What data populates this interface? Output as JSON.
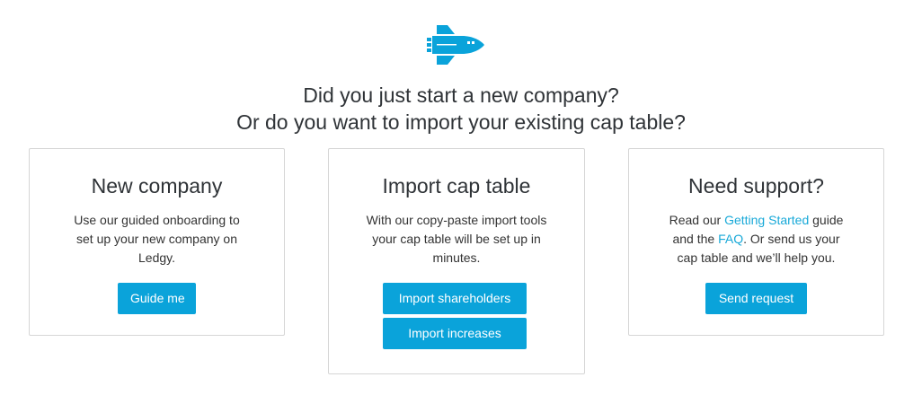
{
  "logo": {
    "icon": "space-shuttle-icon",
    "color": "#0aa3da"
  },
  "headline": {
    "line1": "Did you just start a new company?",
    "line2": "Or do you want to import your existing cap table?"
  },
  "cards": {
    "new_company": {
      "title": "New company",
      "body": "Use our guided onboarding to set up your new company on Ledgy.",
      "button": "Guide me"
    },
    "import": {
      "title": "Import cap table",
      "body": "With our copy-paste import tools your cap table will be set up in minutes.",
      "button_shareholders": "Import shareholders",
      "button_increases": "Import increases"
    },
    "support": {
      "title": "Need support?",
      "body_part1": "Read our ",
      "link_getting_started": "Getting Started",
      "body_part2": " guide and the ",
      "link_faq": "FAQ",
      "body_part3": ". Or send us your cap table and we’ll help you.",
      "button": "Send request"
    }
  },
  "colors": {
    "accent": "#0aa3da",
    "link": "#18a9d8",
    "border": "#d6d6d6",
    "text": "#333333"
  }
}
